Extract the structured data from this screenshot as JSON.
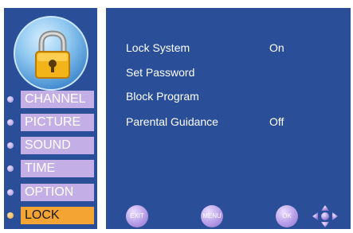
{
  "sidebar": {
    "items": [
      {
        "label": "CHANNEL",
        "active": false
      },
      {
        "label": "PICTURE",
        "active": false
      },
      {
        "label": "SOUND",
        "active": false
      },
      {
        "label": "TIME",
        "active": false
      },
      {
        "label": "OPTION",
        "active": false
      },
      {
        "label": "LOCK",
        "active": true
      }
    ]
  },
  "main": {
    "rows": [
      {
        "label": "Lock System",
        "value": "On"
      },
      {
        "label": "Set Password",
        "value": ""
      },
      {
        "label": "Block Program",
        "value": ""
      },
      {
        "label": "Parental Guidance",
        "value": "Off"
      }
    ]
  },
  "footer": {
    "exit_label": "EXIT",
    "menu_label": "MENU",
    "ok_label": "OK"
  },
  "colors": {
    "panel": "#2a4f98",
    "item_inactive": "#c4aee6",
    "item_active": "#f4a433"
  },
  "icons": {
    "badge": "padlock-icon",
    "nav": "dpad-icon"
  }
}
